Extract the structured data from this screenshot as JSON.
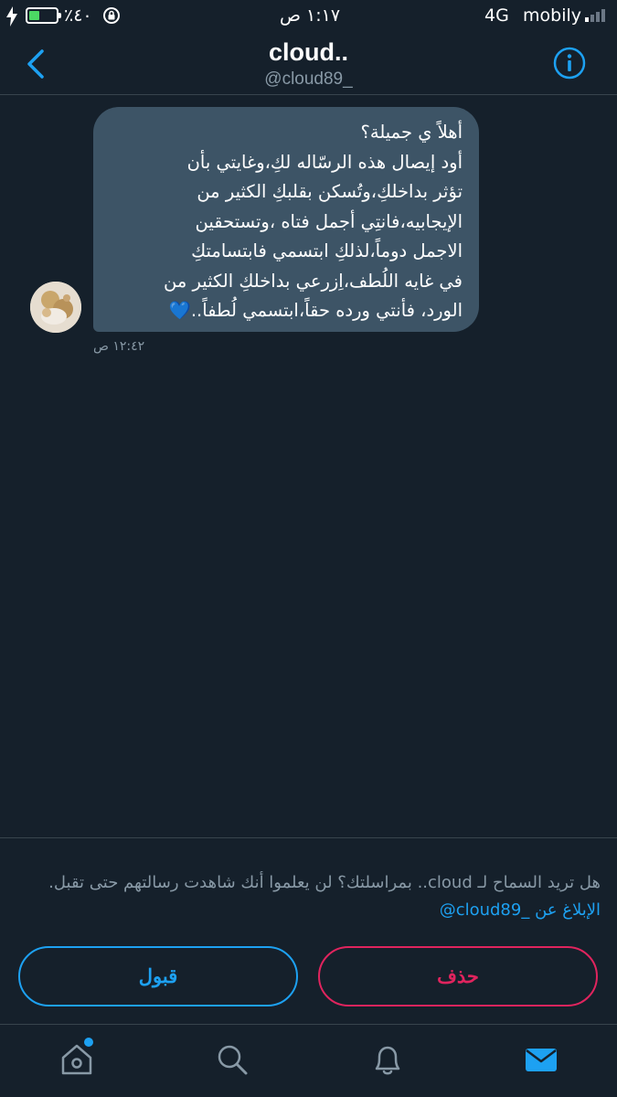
{
  "status_bar": {
    "carrier": "mobily",
    "network": "4G",
    "time": "١:١٧ ص",
    "battery_text": "٪٤٠",
    "battery_level": 0.4,
    "signal_bars_on": 1,
    "signal_bars_total": 4
  },
  "header": {
    "name": "cloud..",
    "handle": "@cloud89_"
  },
  "conversation": {
    "message_lines": [
      "أهلاً ي جميلة؟",
      "أود إيصال هذه الرسّاله لكِ،وغايتي بأن",
      "تؤثر بداخلكِ،وتُسكن بقلبكِ الكثير من",
      "الإيجابيه،فانتِي أجمل فتاه ،وتستحقين",
      "الاجمل دوماً،لذلكِ ابتسمي فابتسامتكِ",
      "في غايه اللُطف،اِزرعي بداخلكِ الكثير من"
    ],
    "message_last_line": "الورد، فأنتي  ورده حقاً،ابتسمي لُطفاً..",
    "message_emoji": "💙",
    "timestamp": "١٢:٤٢ ص"
  },
  "request": {
    "prompt": "هل تريد السماح لـ cloud.. بمراسلتك؟ لن يعلموا أنك شاهدت رسالتهم حتى تقبل.",
    "report_link": "الإبلاغ عن _cloud89@",
    "accept_label": "قبول",
    "delete_label": "حذف"
  },
  "tabbar": {
    "items": [
      "home-icon",
      "search-icon",
      "bell-icon",
      "mail-icon"
    ],
    "active": "mail-icon"
  },
  "colors": {
    "background": "#15202b",
    "bubble": "#3d5466",
    "accent": "#1da1f2",
    "danger": "#e0245e",
    "muted": "#8899a6",
    "divider": "#38444d"
  }
}
